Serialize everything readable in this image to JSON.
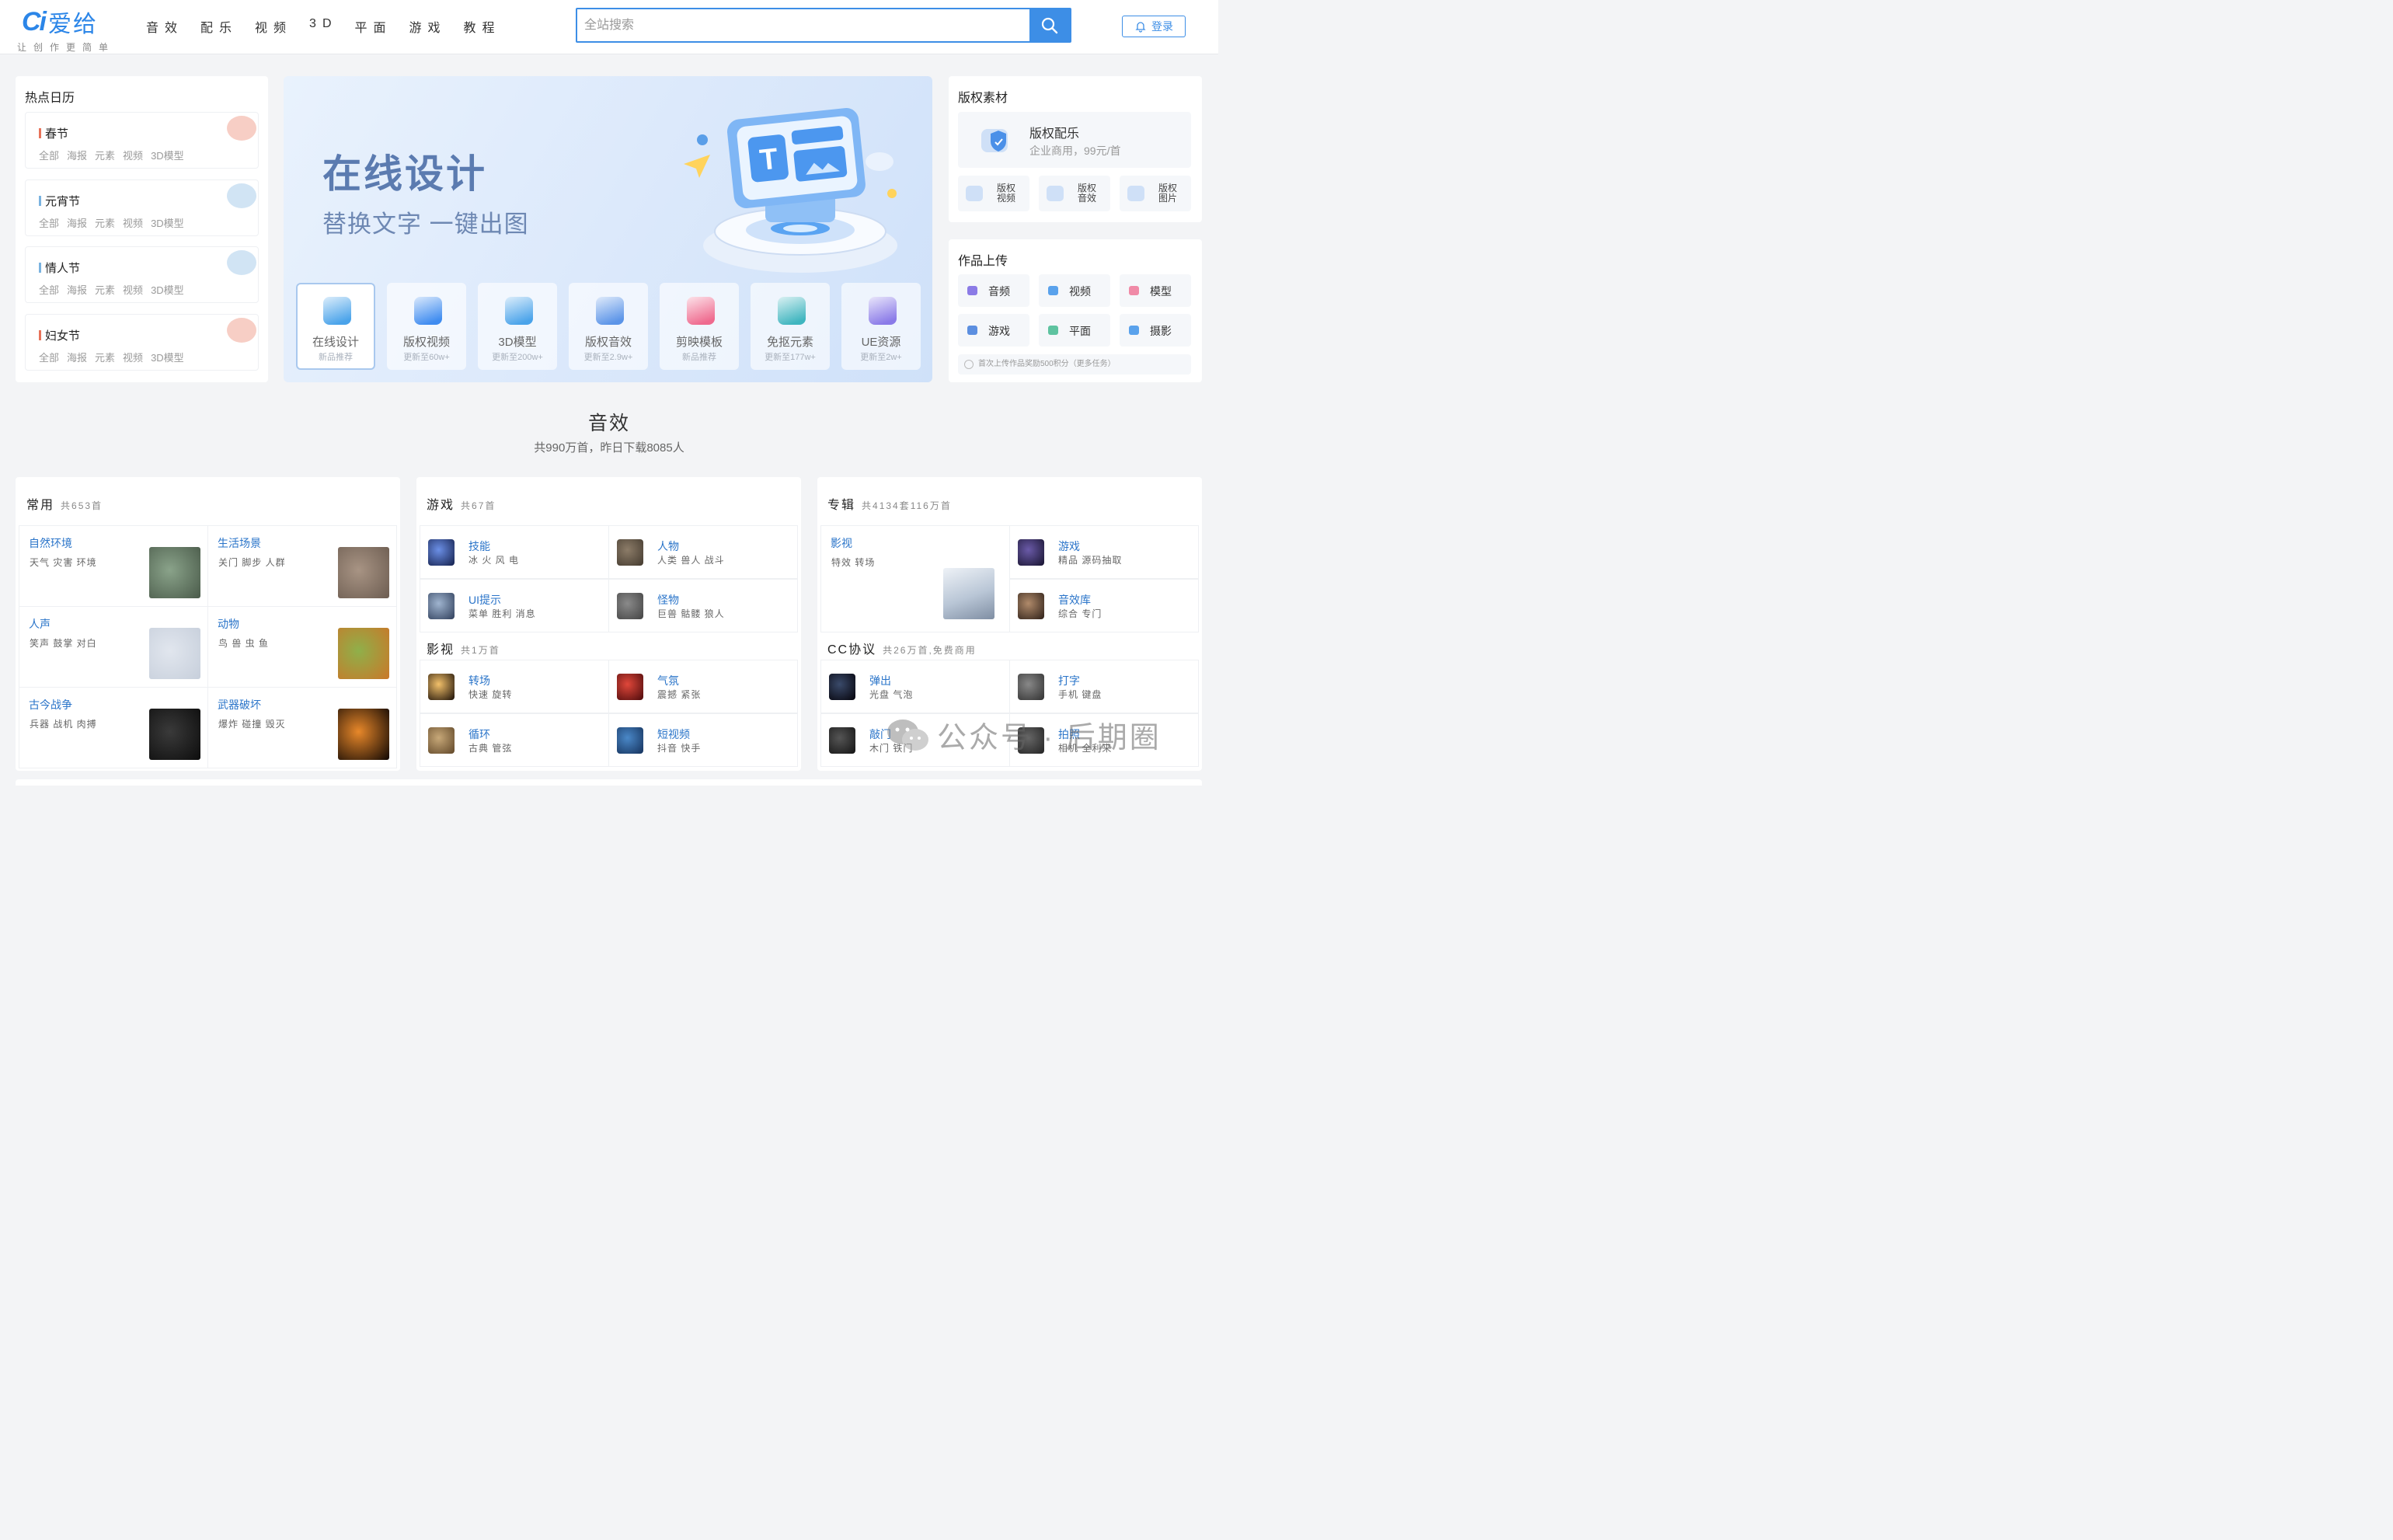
{
  "brand": {
    "logo_mark": "Ci",
    "name": "爱给",
    "slogan": "让创作更简单"
  },
  "nav": [
    "音效",
    "配乐",
    "视频",
    "3D",
    "平面",
    "游戏",
    "教程"
  ],
  "search": {
    "placeholder": "全站搜索",
    "value": ""
  },
  "login_label": "登录",
  "calendar": {
    "title": "热点日历",
    "tags": [
      "全部",
      "海报",
      "元素",
      "视频",
      "3D模型"
    ],
    "items": [
      {
        "name": "春节",
        "color": "#e8735a"
      },
      {
        "name": "元宵节",
        "color": "#7ab3e0"
      },
      {
        "name": "情人节",
        "color": "#7ab3e0"
      },
      {
        "name": "妇女节",
        "color": "#e8735a"
      }
    ]
  },
  "banner": {
    "title": "在线设计",
    "subtitle": "替换文字 一键出图",
    "tiles": [
      {
        "name": "在线设计",
        "sub": "新品推荐",
        "icon": "monitor-icon",
        "color": "#4aa3ea"
      },
      {
        "name": "版权视频",
        "sub": "更新至60w+",
        "icon": "video-camera-icon",
        "color": "#3f8cf0"
      },
      {
        "name": "3D模型",
        "sub": "更新至200w+",
        "icon": "cube-icon",
        "color": "#4aa3ea"
      },
      {
        "name": "版权音效",
        "sub": "更新至2.9w+",
        "icon": "shield-sound-icon",
        "color": "#5b94e8"
      },
      {
        "name": "剪映模板",
        "sub": "新品推荐",
        "icon": "capcut-icon",
        "color": "#ef6a8e"
      },
      {
        "name": "免抠元素",
        "sub": "更新至177w+",
        "icon": "image-cutout-icon",
        "color": "#3fb5bf"
      },
      {
        "name": "UE资源",
        "sub": "更新至2w+",
        "icon": "unreal-icon",
        "color": "#8a7ae8"
      }
    ]
  },
  "copyright": {
    "title": "版权素材",
    "main": {
      "name": "版权配乐",
      "desc": "企业商用，99元/首"
    },
    "subs": [
      {
        "line1": "版权",
        "line2": "视频"
      },
      {
        "line1": "版权",
        "line2": "音效"
      },
      {
        "line1": "版权",
        "line2": "图片"
      }
    ]
  },
  "upload": {
    "title": "作品上传",
    "buttons": [
      {
        "label": "音频",
        "color": "#8b7be6"
      },
      {
        "label": "视频",
        "color": "#5aa2ec"
      },
      {
        "label": "模型",
        "color": "#f08aa7"
      },
      {
        "label": "游戏",
        "color": "#5c8fe0"
      },
      {
        "label": "平面",
        "color": "#5ec3a0"
      },
      {
        "label": "摄影",
        "color": "#5aa2ec"
      }
    ],
    "tip": "首次上传作品奖励500积分（更多任务）"
  },
  "section": {
    "title": "音效",
    "subtitle": "共990万首，昨日下载8085人"
  },
  "panels": {
    "common": {
      "title": "常用",
      "count": "共653首",
      "cells": [
        {
          "name": "自然环境",
          "tags": "天气 灾害 环境",
          "colors": [
            "#8aa38a",
            "#4d5e4d"
          ]
        },
        {
          "name": "生活场景",
          "tags": "关门 脚步 人群",
          "colors": [
            "#a89484",
            "#6f5f53"
          ]
        },
        {
          "name": "人声",
          "tags": "笑声 鼓掌 对白",
          "colors": [
            "#e1e6ee",
            "#c8d0dc"
          ]
        },
        {
          "name": "动物",
          "tags": "鸟 兽 虫 鱼",
          "colors": [
            "#8fb04a",
            "#c77a2a"
          ]
        },
        {
          "name": "古今战争",
          "tags": "兵器 战机 肉搏",
          "colors": [
            "#3a3a3a",
            "#0f0f0f"
          ]
        },
        {
          "name": "武器破坏",
          "tags": "爆炸 碰撞 毁灭",
          "colors": [
            "#e8882a",
            "#1a0d05"
          ]
        }
      ]
    },
    "game": {
      "title": "游戏",
      "count": "共67首",
      "items": [
        {
          "name": "技能",
          "tags": "冰 火 风 电",
          "colors": [
            "#6b8fe6",
            "#1c2a5a"
          ]
        },
        {
          "name": "人物",
          "tags": "人类 兽人 战斗",
          "colors": [
            "#8c7c68",
            "#4a4034"
          ]
        },
        {
          "name": "UI提示",
          "tags": "菜单 胜利 消息",
          "colors": [
            "#9fb4cf",
            "#3a4a66"
          ]
        },
        {
          "name": "怪物",
          "tags": "巨兽 骷髅 狼人",
          "colors": [
            "#8a8a8a",
            "#4a4a4a"
          ]
        }
      ]
    },
    "film": {
      "title": "影视",
      "count": "共1万首",
      "items": [
        {
          "name": "转场",
          "tags": "快速 旋转",
          "colors": [
            "#f2c06a",
            "#2e1f10"
          ]
        },
        {
          "name": "气氛",
          "tags": "震撼 紧张",
          "colors": [
            "#e0473a",
            "#5a1010"
          ]
        },
        {
          "name": "循环",
          "tags": "古典 管弦",
          "colors": [
            "#c7a878",
            "#6a5030"
          ]
        },
        {
          "name": "短视频",
          "tags": "抖音 快手",
          "colors": [
            "#4a88c8",
            "#1a3a66"
          ]
        }
      ]
    },
    "album": {
      "title": "专辑",
      "count": "共4134套116万首",
      "feature": {
        "name": "影视",
        "tags": "特效 转场"
      },
      "items": [
        {
          "name": "游戏",
          "tags": "精品 源码抽取",
          "colors": [
            "#6a5aa8",
            "#1f1a3a"
          ]
        },
        {
          "name": "音效库",
          "tags": "综合 专门",
          "colors": [
            "#b08a6a",
            "#3a2a20"
          ]
        }
      ]
    },
    "cc": {
      "title": "CC协议",
      "count": "共26万首,免费商用",
      "items": [
        {
          "name": "弹出",
          "tags": "光盘 气泡",
          "colors": [
            "#3a4a6a",
            "#0a0a14"
          ]
        },
        {
          "name": "打字",
          "tags": "手机 键盘",
          "colors": [
            "#888888",
            "#3a3a3a"
          ]
        },
        {
          "name": "敲门",
          "tags": "木门 铁门",
          "colors": [
            "#555555",
            "#1a1a1a"
          ]
        },
        {
          "name": "拍照",
          "tags": "相机 全利来",
          "colors": [
            "#666666",
            "#2a2a2a"
          ]
        }
      ]
    }
  },
  "watermark": "公众号 · 后期圈"
}
